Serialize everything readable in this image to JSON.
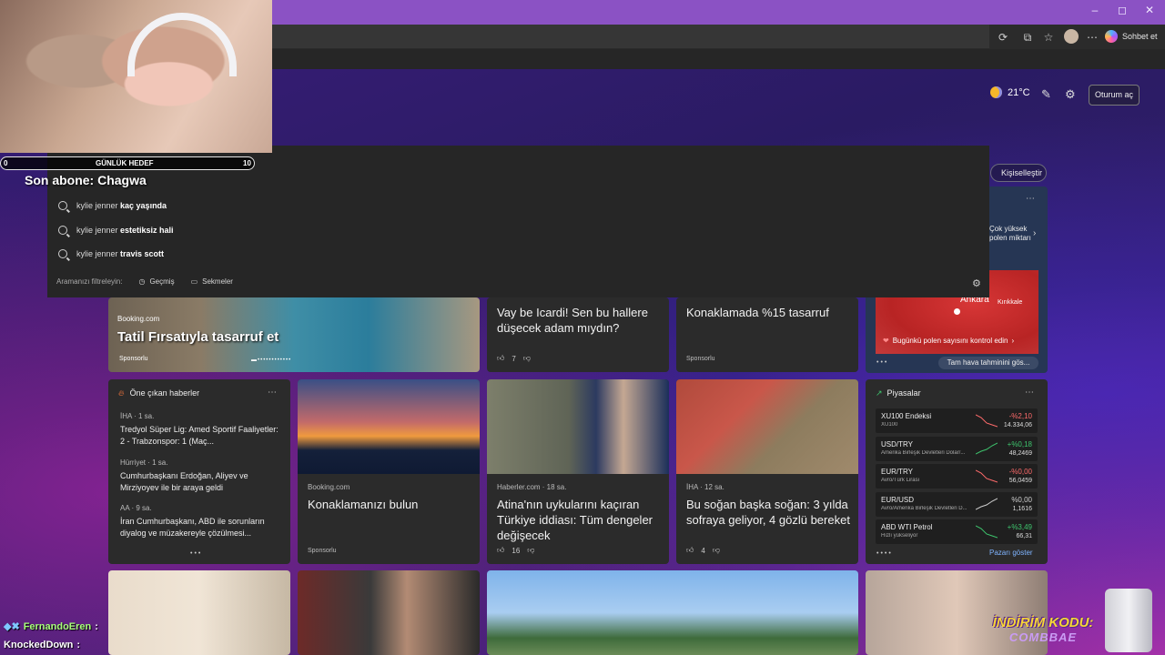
{
  "window": {
    "minimize": "–",
    "maximize": "◻",
    "close": "✕"
  },
  "toolbar": {
    "copilot_label": "Sohbet et"
  },
  "header": {
    "temperature": "21°C",
    "signin_label": "Oturum aç",
    "personalize_label": "Kişiselleştir"
  },
  "search_dropdown": {
    "suggestions": [
      {
        "prefix": "kylie jenner ",
        "bold": "kaç yaşında"
      },
      {
        "prefix": "kylie jenner ",
        "bold": "estetiksiz hali"
      },
      {
        "prefix": "kylie jenner ",
        "bold": "travis scott"
      }
    ],
    "filter_label": "Aramanızı filtreleyin:",
    "filter_history": "Geçmiş",
    "filter_tabs": "Sekmeler"
  },
  "stream_overlay": {
    "goal_start": "0",
    "goal_label": "GÜNLÜK HEDEF",
    "goal_end": "10",
    "last_sub": "Son abone: Chagwa",
    "chat": [
      {
        "user": "FernandoEren",
        "suffix": ":"
      },
      {
        "user": "KnockedDown",
        "suffix": ":"
      }
    ],
    "promo_line1": "İNDİRİM KODU:",
    "promo_line2": "COMBBAE"
  },
  "cards": {
    "hero": {
      "source": "Booking.com",
      "title": "Tatil Fırsatıyla tasarruf et",
      "sponsor": "Sponsorlu"
    },
    "icardi": {
      "title": "Vay be Icardi! Sen bu hallere düşecek adam mıydın?",
      "likes": "7"
    },
    "konaklama15": {
      "title": "Konaklamada %15 tasarruf",
      "sponsor": "Sponsorlu"
    },
    "weather_map": {
      "alert": "Çok yüksek polen miktarı",
      "city": "Ankara",
      "city2": "Kırıkkale",
      "pollen_link": "Bugünkü polen sayısını kontrol edin",
      "forecast_btn": "Tam hava tahminini gös..."
    },
    "top_news": {
      "header": "Öne çıkan haberler",
      "items": [
        {
          "source": "İHA · 1 sa.",
          "title": "Tredyol Süper Lig: Amed Sportif Faaliyetler: 2 - Trabzonspor: 1 (Maç..."
        },
        {
          "source": "Hürriyet · 1 sa.",
          "title": "Cumhurbaşkanı Erdoğan, Aliyev ve Mirziyoyev ile bir araya geldi"
        },
        {
          "source": "AA · 9 sa.",
          "title": "İran Cumhurbaşkanı, ABD ile sorunların diyalog ve müzakereyle çözülmesi..."
        }
      ]
    },
    "toronto": {
      "source": "Booking.com",
      "title": "Konaklamanızı bulun",
      "sponsor": "Sponsorlu"
    },
    "atina": {
      "source": "Haberler.com · 18 sa.",
      "title": "Atina'nın uykularını kaçıran Türkiye iddiası: Tüm dengeler değişecek",
      "likes": "16"
    },
    "sogan": {
      "source": "İHA · 12 sa.",
      "title": "Bu soğan başka soğan: 3 yılda sofraya geliyor, 4 gözlü bereket",
      "likes": "4"
    },
    "markets": {
      "header": "Piyasalar",
      "rows": [
        {
          "name": "XU100 Endeksi",
          "sub": "XU100",
          "change": "-%2,10",
          "value": "14.334,06",
          "color": "#ff6b6b"
        },
        {
          "name": "USD/TRY",
          "sub": "Amerika Birleşik Devletleri Dolar/...",
          "change": "+%0,18",
          "value": "48,2469",
          "color": "#3ec46d"
        },
        {
          "name": "EUR/TRY",
          "sub": "Avro/Türk Lirası",
          "change": "-%0,00",
          "value": "56,0459",
          "color": "#ff6b6b"
        },
        {
          "name": "EUR/USD",
          "sub": "Avro/Amerika Birleşik Devletleri D...",
          "change": "%0,00",
          "value": "1,1616",
          "color": "#cfcfcf"
        },
        {
          "name": "ABD WTI Petrol",
          "sub": "Hızlı yükseliyor",
          "change": "+%3,49",
          "value": "66,31",
          "color": "#3ec46d"
        }
      ],
      "more": "Pazarı göster"
    }
  },
  "colors": {
    "accent": "#8b52c4",
    "link": "#7fb4ff",
    "positive": "#3ec46d",
    "negative": "#ff6b6b"
  }
}
